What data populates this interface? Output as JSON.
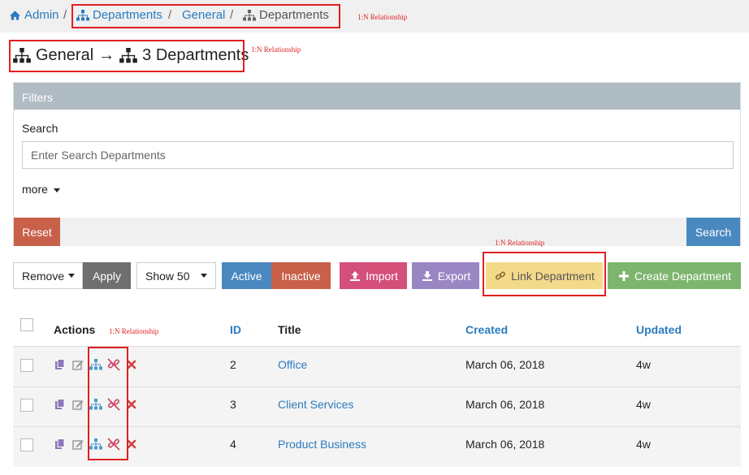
{
  "breadcrumb": {
    "admin": "Admin",
    "departments": "Departments",
    "general": "General",
    "current": "Departments",
    "separator": "/"
  },
  "annotation": "1:N Relationship",
  "page_title": {
    "left": "General",
    "arrow": "→",
    "right": "3 Departments"
  },
  "filters": {
    "header": "Filters",
    "search_label": "Search",
    "search_placeholder": "Enter Search Departments",
    "more": "more",
    "reset": "Reset",
    "search_button": "Search"
  },
  "toolbar": {
    "bulk_select": "Remove",
    "apply": "Apply",
    "show": "Show 50",
    "active": "Active",
    "inactive": "Inactive",
    "import": "Import",
    "export": "Export",
    "link": "Link Department",
    "create": "Create Department"
  },
  "table": {
    "columns": [
      "Actions",
      "ID",
      "Title",
      "Created",
      "Updated"
    ],
    "rows": [
      {
        "id": "2",
        "title": "Office",
        "created": "March 06, 2018",
        "updated": "4w"
      },
      {
        "id": "3",
        "title": "Client Services",
        "created": "March 06, 2018",
        "updated": "4w"
      },
      {
        "id": "4",
        "title": "Product Business",
        "created": "March 06, 2018",
        "updated": "4w"
      }
    ]
  },
  "colors": {
    "link": "#2a7bbf",
    "annotation": "#e02020",
    "reset": "#c8604a",
    "search": "#4a88c0",
    "apply": "#6f6f6f",
    "active": "#4a88c0",
    "inactive": "#c8604a",
    "import": "#d44f7a",
    "export": "#9b86c4",
    "link_btn": "#f3d98a",
    "create": "#7db56e"
  },
  "icons": [
    "home-icon",
    "sitemap-icon",
    "link-icon",
    "unlink-icon",
    "copy-icon",
    "edit-icon",
    "delete-icon",
    "upload-icon",
    "download-icon",
    "plus-icon",
    "caret-down-icon"
  ]
}
